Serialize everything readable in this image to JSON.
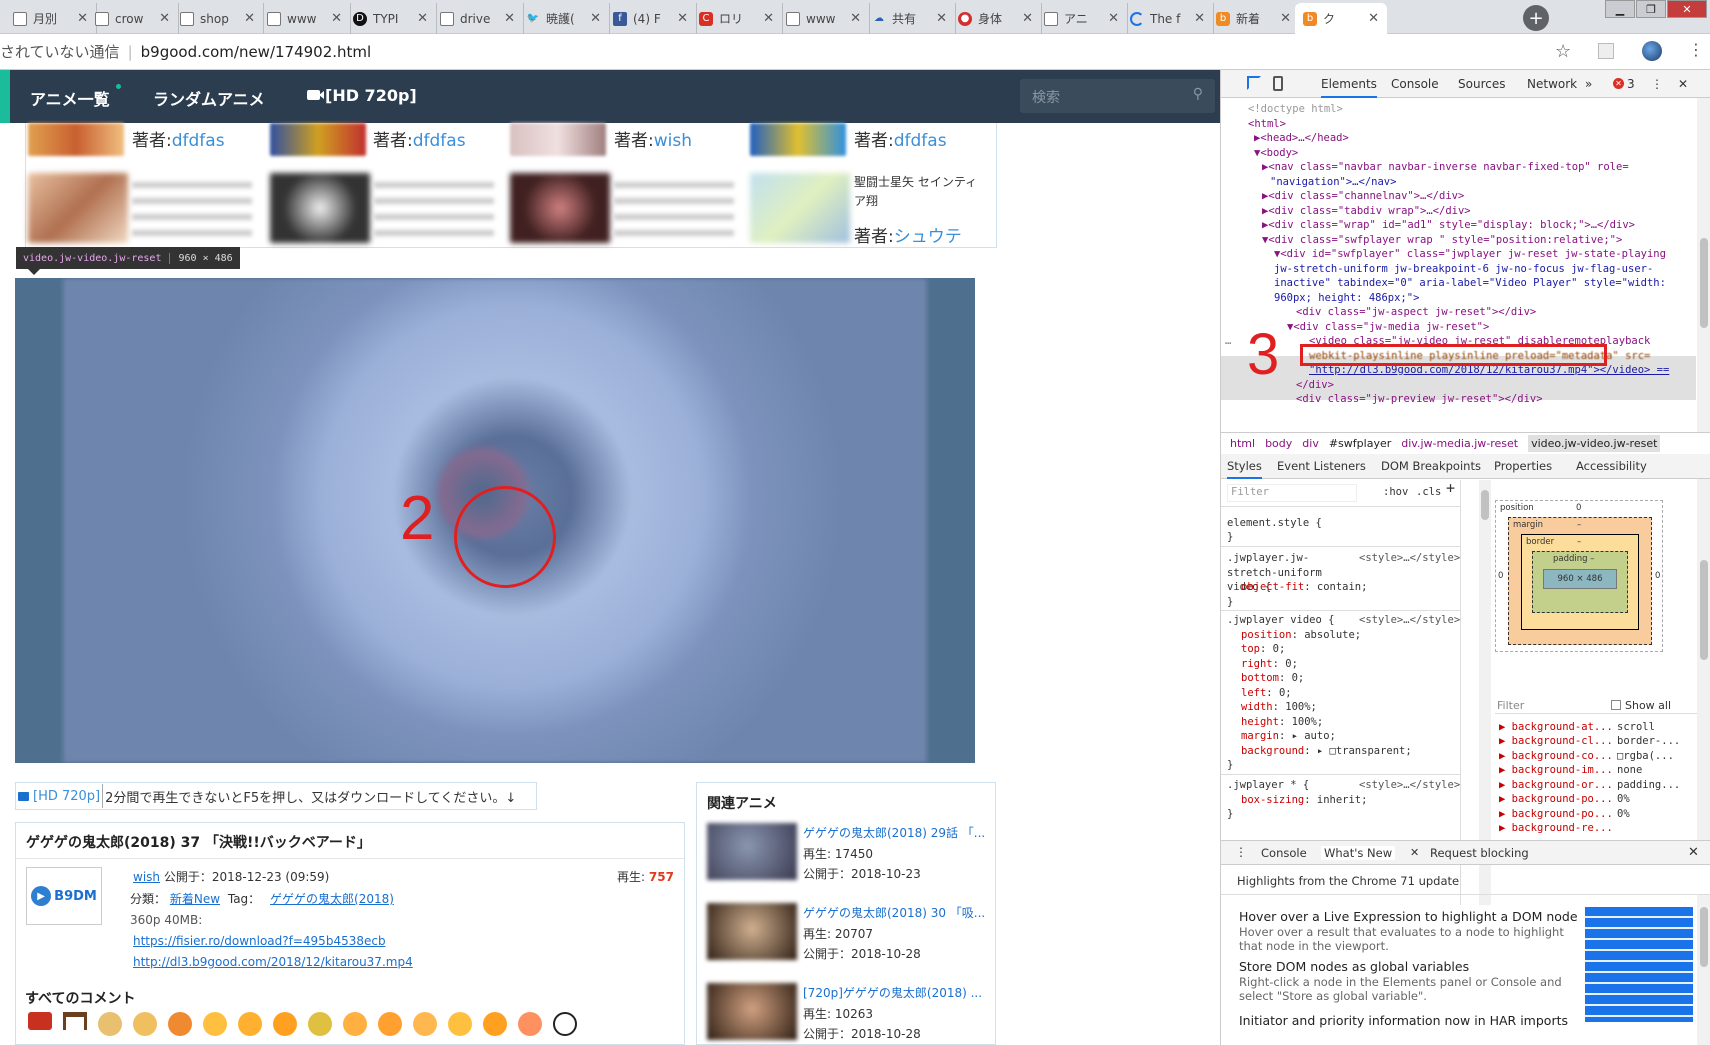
{
  "tabs": [
    {
      "label": "月別",
      "icon": "doc"
    },
    {
      "label": "crow",
      "icon": "doc"
    },
    {
      "label": "shop",
      "icon": "doc"
    },
    {
      "label": "www",
      "icon": "doc"
    },
    {
      "label": "TYPI",
      "icon": "d"
    },
    {
      "label": "drive",
      "icon": "doc"
    },
    {
      "label": "暁護(",
      "icon": "twitter"
    },
    {
      "label": "(4) F",
      "icon": "facebook"
    },
    {
      "label": "ロリ",
      "icon": "red"
    },
    {
      "label": "www",
      "icon": "doc"
    },
    {
      "label": "共有",
      "icon": "cloud"
    },
    {
      "label": "身体",
      "icon": "target"
    },
    {
      "label": "アニ",
      "icon": "doc"
    },
    {
      "label": "The f",
      "icon": "loading"
    },
    {
      "label": "新着",
      "icon": "b"
    },
    {
      "label": "ク",
      "icon": "b",
      "active": true
    }
  ],
  "address": {
    "security": "されていない通信",
    "url": "b9good.com/new/174902.html"
  },
  "site": {
    "nav": {
      "anime_list": "アニメ一覧",
      "random": "ランダムアニメ",
      "hd": "[HD 720p]",
      "search_placeholder": "検索"
    },
    "thumb_row1": [
      {
        "prefix": "著者:",
        "author": "dfdfas"
      },
      {
        "prefix": "著者:",
        "author": "dfdfas"
      },
      {
        "prefix": "著者:",
        "author": "wish"
      },
      {
        "prefix": "著者:",
        "author": "dfdfas"
      }
    ],
    "thumb_row2_last": {
      "title": "聖闘士星矢 セインティア翔",
      "prefix": "著者:",
      "author": "シュウテ"
    },
    "tooltip": {
      "selector": "video.jw-video.jw-reset",
      "size": "960 × 486"
    },
    "annotations": {
      "mark2": "2",
      "mark3": "3"
    },
    "hd_notice": {
      "label": "[HD 720p]",
      "text": "2分間で再生できないとF5を押し、又はダウンロードしてください。↓"
    },
    "post": {
      "title": "ゲゲゲの鬼太郎(2018) 37 「決戦!!バックベアード」",
      "author": "wish",
      "published_label": "公開于：",
      "published": "2018-12-23 (09:59)",
      "plays_label": "再生:",
      "plays": "757",
      "category_label": "分類：",
      "category": "新着New",
      "tag_label": "Tag：",
      "tag": "ゲゲゲの鬼太郎(2018)",
      "size": "360p 40MB:",
      "link1": "https://fisier.ro/download?f=495b4538ecb",
      "link2": "http://dl3.b9good.com/2018/12/kitarou37.mp4",
      "logo": "B9DM"
    },
    "comments_title": "すべてのコメント",
    "related": {
      "title": "関連アニメ",
      "items": [
        {
          "title": "ゲゲゲの鬼太郎(2018) 29話 「...",
          "plays": "再生: 17450",
          "date": "公開于：2018-10-23"
        },
        {
          "title": "ゲゲゲの鬼太郎(2018) 30 「吸...",
          "plays": "再生: 20707",
          "date": "公開于：2018-10-28"
        },
        {
          "title": "[720p]ゲゲゲの鬼太郎(2018) ...",
          "plays": "再生: 10263",
          "date": "公開于：2018-10-28"
        }
      ]
    }
  },
  "devtools": {
    "tabs": [
      "Elements",
      "Console",
      "Sources",
      "Network"
    ],
    "more": "»",
    "errors": "3",
    "dom_lines": [
      "<!doctype html>",
      "<html>",
      "▶<head>…</head>",
      "▼<body>",
      "▶<nav class=\"navbar navbar-inverse navbar-fixed-top\" role=",
      "\"navigation\">…</nav>",
      "▶<div class=\"channelnav\">…</div>",
      "▶<div class=\"tabdiv wrap\">…</div>",
      "▶<div class=\"wrap\" id=\"ad1\" style=\"display: block;\">…</div>",
      "▼<div class=\"swfplayer wrap \" style=\"position:relative;\">",
      "▼<div id=\"swfplayer\" class=\"jwplayer jw-reset jw-state-playing",
      "jw-stretch-uniform jw-breakpoint-6 jw-no-focus jw-flag-user-",
      "inactive\" tabindex=\"0\" aria-label=\"Video Player\" style=\"width:",
      "960px; height: 486px;\">",
      "<div class=\"jw-aspect jw-reset\"></div>",
      "▼<div class=\"jw-media jw-reset\">",
      "<video class=\"jw-video jw-reset\" disableremoteplayback",
      "webkit-playsinline playsinline preload=\"metadata\" src=",
      "\"http://dl3.b9good.com/2018/12/kitarou37.mp4\"></video> ==",
      "</div>",
      "<div class=\"jw-preview jw-reset\"></div>"
    ],
    "breadcrumb": [
      "html",
      "body",
      "div",
      "#swfplayer",
      "div.jw-media.jw-reset",
      "video.jw-video.jw-reset"
    ],
    "style_tabs": [
      "Styles",
      "Event Listeners",
      "DOM Breakpoints",
      "Properties",
      "Accessibility"
    ],
    "filter_placeholder": "Filter",
    "hov": ":hov",
    "cls": ".cls",
    "rules": [
      {
        "sel": "element.style {",
        "src": "",
        "decls": [],
        "close": "}"
      },
      {
        "sel": ".jwplayer.jw-stretch-uniform video {",
        "src": "<style>…</style>",
        "decls": [
          [
            "object-fit",
            "contain;"
          ]
        ],
        "close": "}"
      },
      {
        "sel": ".jwplayer video {",
        "src": "<style>…</style>",
        "decls": [
          [
            "position",
            "absolute;"
          ],
          [
            "top",
            "0;"
          ],
          [
            "right",
            "0;"
          ],
          [
            "bottom",
            "0;"
          ],
          [
            "left",
            "0;"
          ],
          [
            "width",
            "100%;"
          ],
          [
            "height",
            "100%;"
          ],
          [
            "margin",
            "▸ auto;"
          ],
          [
            "background",
            "▸ □transparent;"
          ]
        ],
        "close": "}"
      },
      {
        "sel": ".jwplayer * {",
        "src": "<style>…</style>",
        "decls": [
          [
            "box-sizing",
            "inherit;"
          ]
        ],
        "close": "}"
      }
    ],
    "boxmodel": {
      "position_label": "position",
      "position": "0",
      "margin_label": "margin",
      "margin": "–",
      "border_label": "border",
      "border": "–",
      "padding_label": "padding –",
      "content": "960 × 486",
      "dash": "–",
      "zero": "0"
    },
    "computed_filter": "Filter",
    "show_all": "Show all",
    "computed": [
      [
        "background-at...",
        "scroll"
      ],
      [
        "background-cl...",
        "border-..."
      ],
      [
        "background-co...",
        "□rgba(..."
      ],
      [
        "background-im...",
        "none"
      ],
      [
        "background-or...",
        "padding..."
      ],
      [
        "background-po...",
        "0%"
      ],
      [
        "background-po...",
        "0%"
      ],
      [
        "background-re...",
        ""
      ]
    ],
    "drawer_tabs": [
      "Console",
      "What's New",
      "Request blocking"
    ],
    "whats_new_header": "Highlights from the Chrome 71 update",
    "whats_new": [
      {
        "title": "Hover over a Live Expression to highlight a DOM node",
        "desc": "Hover over a result that evaluates to a node to highlight that node in the viewport."
      },
      {
        "title": "Store DOM nodes as global variables",
        "desc": "Right-click a node in the Elements panel or Console and select \"Store as global variable\"."
      },
      {
        "title": "Initiator and priority information now in HAR imports",
        "desc": ""
      }
    ]
  },
  "colors": {
    "navbar": "#2b3d4f",
    "accent": "#1abc9c",
    "link": "#3a8fd8",
    "annotation": "#e02020",
    "video_bg": "#4b6887"
  }
}
